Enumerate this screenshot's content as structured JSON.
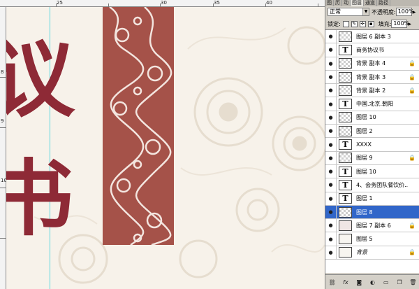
{
  "panel": {
    "tabs": [
      "图",
      "历",
      "动",
      "图层",
      "通道",
      "路径"
    ],
    "blend_mode": "正常",
    "opacity_label": "不透明度:",
    "opacity_value": "100%",
    "lock_label": "锁定:",
    "fill_label": "填充:",
    "fill_value": "100%"
  },
  "layers": [
    {
      "name": "图层 6 副本 3",
      "thumb": "checker",
      "locked": false,
      "selected": false,
      "italic": false
    },
    {
      "name": "商务协议书",
      "thumb": "text",
      "locked": false,
      "selected": false,
      "italic": false
    },
    {
      "name": "背景 副本 4",
      "thumb": "checker",
      "locked": true,
      "selected": false,
      "italic": false
    },
    {
      "name": "背景 副本 3",
      "thumb": "checker",
      "locked": true,
      "selected": false,
      "italic": false
    },
    {
      "name": "背景 副本 2",
      "thumb": "checker",
      "locked": true,
      "selected": false,
      "italic": false
    },
    {
      "name": "中国.北京.朝阳",
      "thumb": "text",
      "locked": false,
      "selected": false,
      "italic": false
    },
    {
      "name": "图层 10",
      "thumb": "checker",
      "locked": false,
      "selected": false,
      "italic": false
    },
    {
      "name": "图层 2",
      "thumb": "checker",
      "locked": false,
      "selected": false,
      "italic": false
    },
    {
      "name": "XXXX",
      "thumb": "text",
      "locked": false,
      "selected": false,
      "italic": false
    },
    {
      "name": "图层 9",
      "thumb": "checker",
      "locked": true,
      "selected": false,
      "italic": false
    },
    {
      "name": "图层 10",
      "thumb": "text",
      "locked": false,
      "selected": false,
      "italic": false
    },
    {
      "name": "4、会务团队餐饮价...",
      "thumb": "text",
      "locked": false,
      "selected": false,
      "italic": false
    },
    {
      "name": "图层 1",
      "thumb": "text",
      "locked": false,
      "selected": false,
      "italic": false
    },
    {
      "name": "图层 8",
      "thumb": "checker",
      "locked": false,
      "selected": true,
      "italic": false
    },
    {
      "name": "图层 7 副本 6",
      "thumb": "pinkish",
      "locked": true,
      "selected": false,
      "italic": false
    },
    {
      "name": "图层 5",
      "thumb": "plain",
      "locked": false,
      "selected": false,
      "italic": false
    },
    {
      "name": "背景",
      "thumb": "plain",
      "locked": true,
      "selected": false,
      "italic": true
    }
  ],
  "canvas": {
    "big_chars": [
      "议",
      "书"
    ],
    "ruler_h_labels": [
      "25",
      "30",
      "35",
      "40"
    ],
    "ruler_v_labels": [
      "8",
      "9",
      "10"
    ]
  },
  "colors": {
    "accent": "#8e2a36",
    "pattern": "#a55249",
    "selected": "#3166c9"
  }
}
